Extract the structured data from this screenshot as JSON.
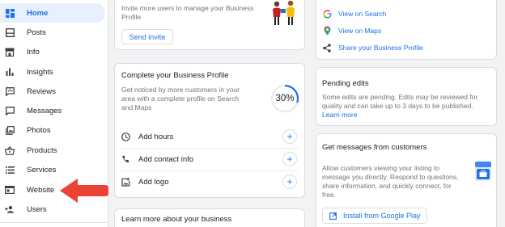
{
  "sidebar": {
    "items": [
      {
        "label": "Home",
        "icon": "dashboard-icon",
        "active": true
      },
      {
        "label": "Posts",
        "icon": "posts-icon"
      },
      {
        "label": "Info",
        "icon": "storefront-icon"
      },
      {
        "label": "Insights",
        "icon": "bar-chart-icon"
      },
      {
        "label": "Reviews",
        "icon": "reviews-icon"
      },
      {
        "label": "Messages",
        "icon": "messages-icon"
      },
      {
        "label": "Photos",
        "icon": "photos-icon"
      },
      {
        "label": "Products",
        "icon": "basket-icon"
      },
      {
        "label": "Services",
        "icon": "list-icon"
      },
      {
        "label": "Website",
        "icon": "web-icon"
      },
      {
        "label": "Users",
        "icon": "add-person-icon"
      }
    ]
  },
  "invite_card": {
    "text_line1": "Invite more users to manage your Business",
    "text_line2": "Profile",
    "button": "Send invite"
  },
  "complete_card": {
    "title": "Complete your Business Profile",
    "desc_line1": "Get noticed by more customers in your",
    "desc_line2": "area with a complete profile on Search",
    "desc_line3": "and Maps",
    "percent": "30%",
    "progress": 0.3,
    "actions": [
      {
        "label": "Add hours",
        "icon": "clock-icon"
      },
      {
        "label": "Add contact info",
        "icon": "phone-icon"
      },
      {
        "label": "Add logo",
        "icon": "add-photo-icon"
      }
    ]
  },
  "learn_card": {
    "title": "Learn more about your business"
  },
  "links_card": {
    "items": [
      {
        "label": "View on Search",
        "icon": "google-icon"
      },
      {
        "label": "View on Maps",
        "icon": "maps-pin-icon"
      },
      {
        "label": "Share your Business Profile",
        "icon": "share-icon"
      }
    ]
  },
  "pending_card": {
    "title": "Pending edits",
    "line1": "Some edits are pending. Edits may be reviewed for",
    "line2": "quality and can take up to 3 days to be published.",
    "link": "Learn more"
  },
  "messages_card": {
    "title": "Get messages from customers",
    "line1": "Allow customers viewing your listing to",
    "line2": "message you directly. Respond to questions,",
    "line3": "share information, and quickly connect, for",
    "line4": "free.",
    "button": "Install from Google Play"
  },
  "colors": {
    "accent": "#1a73e8",
    "arrow": "#ea4335",
    "active_bg": "#e8f0fe"
  }
}
